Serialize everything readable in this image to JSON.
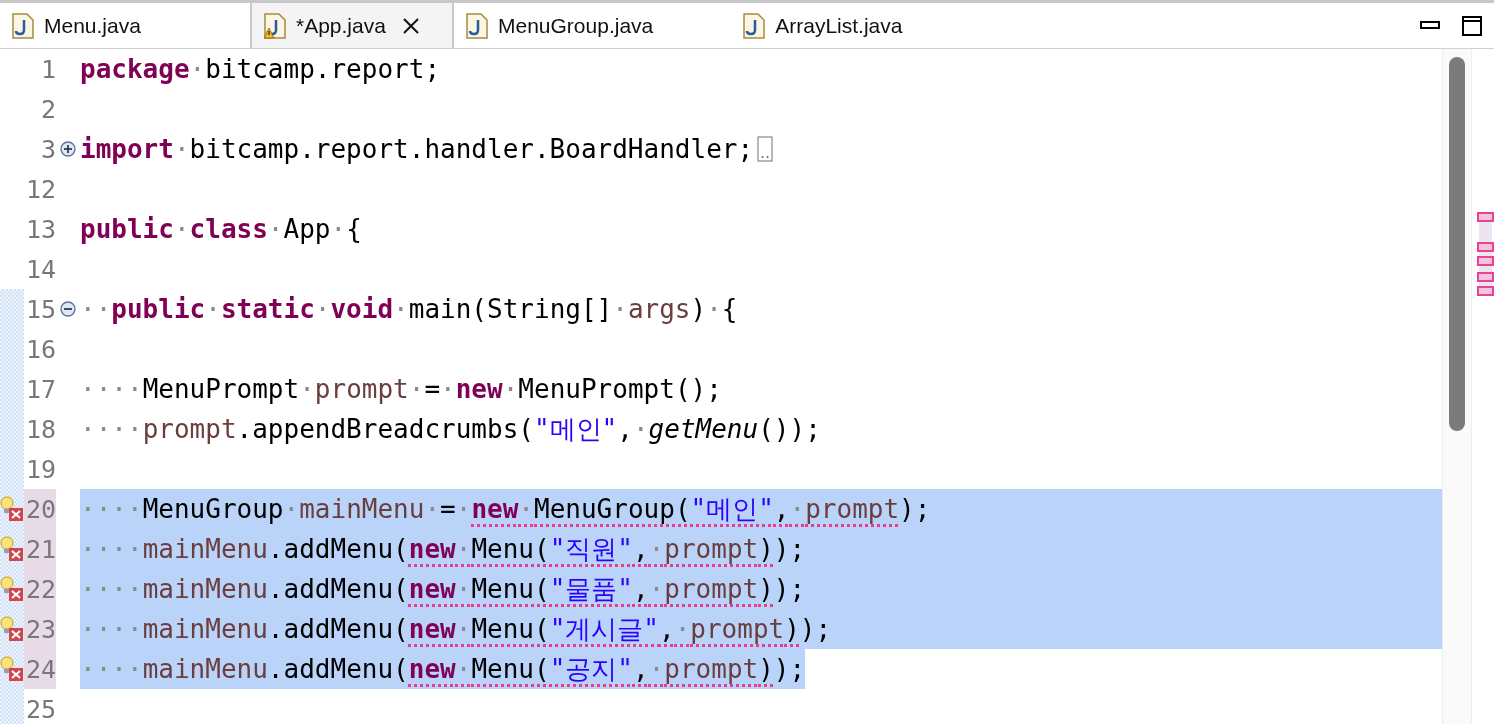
{
  "tabs": [
    {
      "label": "Menu.java",
      "selected": false,
      "warning": false,
      "closable": false
    },
    {
      "label": "*App.java",
      "selected": true,
      "warning": true,
      "closable": true
    },
    {
      "label": "MenuGroup.java",
      "selected": false,
      "warning": false,
      "closable": false
    },
    {
      "label": "ArrayList.java",
      "selected": false,
      "warning": false,
      "closable": false
    }
  ],
  "editor": {
    "lines": [
      {
        "number": "1",
        "in_diff": false,
        "range_marked": false,
        "error": false,
        "foldable": false,
        "folded": false,
        "selected": false,
        "tokens": [
          {
            "text": "package",
            "kind": "kw"
          },
          {
            "text": "·",
            "kind": "ws"
          },
          {
            "text": "bitcamp.report;",
            "kind": "plain"
          }
        ]
      },
      {
        "number": "2",
        "in_diff": false,
        "range_marked": false,
        "error": false,
        "foldable": false,
        "folded": false,
        "selected": false
      },
      {
        "number": "3",
        "in_diff": false,
        "range_marked": false,
        "error": false,
        "foldable": true,
        "folded": true,
        "selected": false,
        "tokens": [
          {
            "text": "import",
            "kind": "kw"
          },
          {
            "text": "·",
            "kind": "ws"
          },
          {
            "text": "bitcamp.report.handler.BoardHandler;",
            "kind": "plain"
          }
        ]
      },
      {
        "number": "12",
        "in_diff": false,
        "range_marked": false,
        "error": false,
        "foldable": false,
        "folded": false,
        "selected": false
      },
      {
        "number": "13",
        "in_diff": false,
        "range_marked": false,
        "error": false,
        "foldable": false,
        "folded": false,
        "selected": false,
        "tokens": [
          {
            "text": "public",
            "kind": "kw"
          },
          {
            "text": "·",
            "kind": "ws"
          },
          {
            "text": "class",
            "kind": "kw"
          },
          {
            "text": "·",
            "kind": "ws"
          },
          {
            "text": "App",
            "kind": "plain"
          },
          {
            "text": "·",
            "kind": "ws"
          },
          {
            "text": "{",
            "kind": "plain"
          }
        ]
      },
      {
        "number": "14",
        "in_diff": false,
        "range_marked": false,
        "error": false,
        "foldable": false,
        "folded": false,
        "selected": false
      },
      {
        "number": "15",
        "in_diff": true,
        "range_marked": false,
        "error": false,
        "foldable": true,
        "folded": false,
        "selected": false,
        "tokens": [
          {
            "text": "··",
            "kind": "ws"
          },
          {
            "text": "public",
            "kind": "kw"
          },
          {
            "text": "·",
            "kind": "ws"
          },
          {
            "text": "static",
            "kind": "kw"
          },
          {
            "text": "·",
            "kind": "ws"
          },
          {
            "text": "void",
            "kind": "kw"
          },
          {
            "text": "·",
            "kind": "ws"
          },
          {
            "text": "main(String[]",
            "kind": "plain"
          },
          {
            "text": "·",
            "kind": "ws"
          },
          {
            "text": "args",
            "kind": "var"
          },
          {
            "text": ")",
            "kind": "plain"
          },
          {
            "text": "·",
            "kind": "ws"
          },
          {
            "text": "{",
            "kind": "plain"
          }
        ]
      },
      {
        "number": "16",
        "in_diff": true,
        "range_marked": false,
        "error": false,
        "foldable": false,
        "folded": false,
        "selected": false
      },
      {
        "number": "17",
        "in_diff": true,
        "range_marked": false,
        "error": false,
        "foldable": false,
        "folded": false,
        "selected": false,
        "tokens": [
          {
            "text": "····",
            "kind": "ws"
          },
          {
            "text": "MenuPrompt",
            "kind": "plain"
          },
          {
            "text": "·",
            "kind": "ws"
          },
          {
            "text": "prompt",
            "kind": "var"
          },
          {
            "text": "·",
            "kind": "ws"
          },
          {
            "text": "=",
            "kind": "plain"
          },
          {
            "text": "·",
            "kind": "ws"
          },
          {
            "text": "new",
            "kind": "kw"
          },
          {
            "text": "·",
            "kind": "ws"
          },
          {
            "text": "MenuPrompt();",
            "kind": "plain"
          }
        ]
      },
      {
        "number": "18",
        "in_diff": true,
        "range_marked": false,
        "error": false,
        "foldable": false,
        "folded": false,
        "selected": false,
        "tokens": [
          {
            "text": "····",
            "kind": "ws"
          },
          {
            "text": "prompt",
            "kind": "var"
          },
          {
            "text": ".appendBreadcrumbs(",
            "kind": "plain"
          },
          {
            "text": "\"메인\"",
            "kind": "str"
          },
          {
            "text": ",",
            "kind": "plain"
          },
          {
            "text": "·",
            "kind": "ws"
          },
          {
            "text": "getMenu",
            "kind": "italic"
          },
          {
            "text": "());",
            "kind": "plain"
          }
        ]
      },
      {
        "number": "19",
        "in_diff": true,
        "range_marked": false,
        "error": false,
        "foldable": false,
        "folded": false,
        "selected": false
      },
      {
        "number": "20",
        "in_diff": true,
        "range_marked": true,
        "error": true,
        "foldable": false,
        "folded": false,
        "selected": true,
        "tokens": [
          {
            "text": "····",
            "kind": "ws"
          },
          {
            "text": "MenuGroup",
            "kind": "plain"
          },
          {
            "text": "·",
            "kind": "ws"
          },
          {
            "text": "mainMenu",
            "kind": "var"
          },
          {
            "text": "·",
            "kind": "ws"
          },
          {
            "text": "=",
            "kind": "plain"
          },
          {
            "text": "·",
            "kind": "ws"
          },
          {
            "kind": "err",
            "children": [
              {
                "text": "new",
                "kind": "kw"
              },
              {
                "text": "·",
                "kind": "ws"
              },
              {
                "text": "MenuGroup(",
                "kind": "plain"
              },
              {
                "text": "\"메인\"",
                "kind": "str"
              },
              {
                "text": ",",
                "kind": "plain"
              },
              {
                "text": "·",
                "kind": "ws"
              },
              {
                "text": "prompt",
                "kind": "var"
              }
            ]
          },
          {
            "text": ");",
            "kind": "plain"
          }
        ]
      },
      {
        "number": "21",
        "in_diff": true,
        "range_marked": true,
        "error": true,
        "foldable": false,
        "folded": false,
        "selected": true,
        "tokens": [
          {
            "text": "····",
            "kind": "ws"
          },
          {
            "text": "mainMenu",
            "kind": "var"
          },
          {
            "text": ".addMenu(",
            "kind": "plain"
          },
          {
            "kind": "err",
            "children": [
              {
                "text": "new",
                "kind": "kw"
              },
              {
                "text": "·",
                "kind": "ws"
              },
              {
                "text": "Menu(",
                "kind": "plain"
              },
              {
                "text": "\"직원\"",
                "kind": "str"
              },
              {
                "text": ",",
                "kind": "plain"
              },
              {
                "text": "·",
                "kind": "ws"
              },
              {
                "text": "prompt",
                "kind": "var"
              },
              {
                "text": ")",
                "kind": "plain"
              }
            ]
          },
          {
            "text": ");",
            "kind": "plain"
          }
        ]
      },
      {
        "number": "22",
        "in_diff": true,
        "range_marked": true,
        "error": true,
        "foldable": false,
        "folded": false,
        "selected": true,
        "tokens": [
          {
            "text": "····",
            "kind": "ws"
          },
          {
            "text": "mainMenu",
            "kind": "var"
          },
          {
            "text": ".addMenu(",
            "kind": "plain"
          },
          {
            "kind": "err",
            "children": [
              {
                "text": "new",
                "kind": "kw"
              },
              {
                "text": "·",
                "kind": "ws"
              },
              {
                "text": "Menu(",
                "kind": "plain"
              },
              {
                "text": "\"물품\"",
                "kind": "str"
              },
              {
                "text": ",",
                "kind": "plain"
              },
              {
                "text": "·",
                "kind": "ws"
              },
              {
                "text": "prompt",
                "kind": "var"
              },
              {
                "text": ")",
                "kind": "plain"
              }
            ]
          },
          {
            "text": ");",
            "kind": "plain"
          }
        ]
      },
      {
        "number": "23",
        "in_diff": true,
        "range_marked": true,
        "error": true,
        "foldable": false,
        "folded": false,
        "selected": true,
        "tokens": [
          {
            "text": "····",
            "kind": "ws"
          },
          {
            "text": "mainMenu",
            "kind": "var"
          },
          {
            "text": ".addMenu(",
            "kind": "plain"
          },
          {
            "kind": "err",
            "children": [
              {
                "text": "new",
                "kind": "kw"
              },
              {
                "text": "·",
                "kind": "ws"
              },
              {
                "text": "Menu(",
                "kind": "plain"
              },
              {
                "text": "\"게시글\"",
                "kind": "str"
              },
              {
                "text": ",",
                "kind": "plain"
              },
              {
                "text": "·",
                "kind": "ws"
              },
              {
                "text": "prompt",
                "kind": "var"
              },
              {
                "text": ")",
                "kind": "plain"
              }
            ]
          },
          {
            "text": ");",
            "kind": "plain"
          }
        ]
      },
      {
        "number": "24",
        "in_diff": true,
        "range_marked": true,
        "error": true,
        "foldable": false,
        "folded": false,
        "selected": true,
        "tokens": [
          {
            "text": "····",
            "kind": "ws"
          },
          {
            "text": "mainMenu",
            "kind": "var"
          },
          {
            "text": ".addMenu(",
            "kind": "plain"
          },
          {
            "kind": "err",
            "children": [
              {
                "text": "new",
                "kind": "kw"
              },
              {
                "text": "·",
                "kind": "ws"
              },
              {
                "text": "Menu(",
                "kind": "plain"
              },
              {
                "text": "\"공지\"",
                "kind": "str"
              },
              {
                "text": ",",
                "kind": "plain"
              },
              {
                "text": "·",
                "kind": "ws"
              },
              {
                "text": "prompt",
                "kind": "var"
              },
              {
                "text": ")",
                "kind": "plain"
              }
            ]
          },
          {
            "text": ");",
            "kind": "plain"
          }
        ]
      },
      {
        "number": "25",
        "in_diff": true,
        "range_marked": false,
        "error": false,
        "foldable": false,
        "folded": false,
        "selected": false
      }
    ]
  }
}
